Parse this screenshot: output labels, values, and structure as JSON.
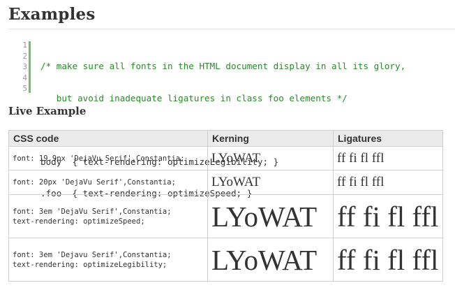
{
  "page": {
    "title": "Examples",
    "live_example_title": "Live Example"
  },
  "code_block": {
    "line_numbers": [
      "1",
      "2",
      "3",
      "4",
      "5"
    ],
    "lines": [
      "/* make sure all fonts in the HTML document display in all its glory,",
      "   but avoid inadequate ligatures in class foo elements */",
      "",
      "body  { text-rendering: optimizeLegibility; }",
      ".foo  { text-rendering: optimizeSpeed; }"
    ]
  },
  "table": {
    "headers": [
      "CSS code",
      "Kerning",
      "Ligatures"
    ],
    "rows": [
      {
        "code": "font: 19.9px 'DejaVu Serif',Constantia;",
        "kerning": "LYoWAT",
        "ligatures": "ff fi fl ffl"
      },
      {
        "code": "font: 20px 'DejaVu Serif',Constantia;",
        "kerning": "LYoWAT",
        "ligatures": "ff fi fl ffl"
      },
      {
        "code": "font: 3em 'DejaVu Serif',Constantia;\ntext-rendering: optimizeSpeed;",
        "kerning": "LYoWAT",
        "ligatures": "ff fi fl ffl"
      },
      {
        "code": "font: 3em 'Dejavu Serif',Constantia;\ntext-rendering: optimizeLegibility;",
        "kerning": "LYoWAT",
        "ligatures": "ff fi fl ffl"
      }
    ]
  },
  "colors": {
    "comment": "#2a8a2a",
    "gutter_bar": "#6ac36a",
    "header_bg": "#ebebeb"
  }
}
